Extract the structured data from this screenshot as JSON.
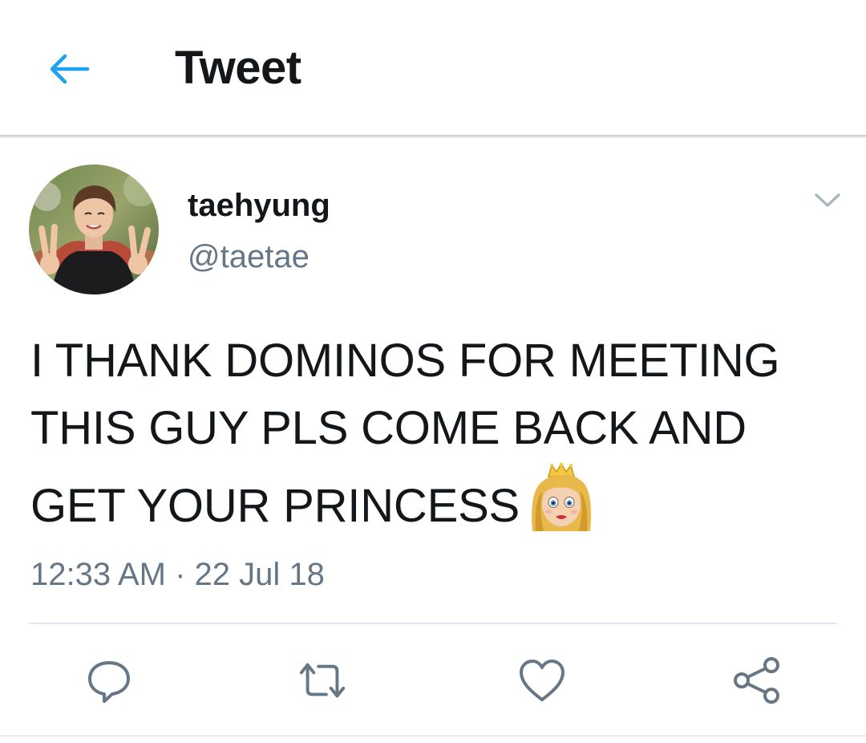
{
  "header": {
    "title": "Tweet",
    "back_icon": "arrow-left-icon",
    "accent_color": "#1da1f2"
  },
  "tweet": {
    "author": {
      "display_name": "taehyung",
      "handle": "@taetae",
      "avatar_icon": "profile-photo"
    },
    "menu_icon": "chevron-down-icon",
    "text": "I THANK DOMINOS FOR MEETING THIS GUY PLS COME BACK AND GET YOUR PRINCESS",
    "emoji": "princess-emoji",
    "timestamp": "12:33 AM · 22 Jul 18",
    "actions": [
      {
        "name": "reply",
        "icon": "reply-icon"
      },
      {
        "name": "retweet",
        "icon": "retweet-icon"
      },
      {
        "name": "like",
        "icon": "heart-icon"
      },
      {
        "name": "share",
        "icon": "share-icon"
      }
    ]
  },
  "colors": {
    "text_primary": "#14171a",
    "text_secondary": "#657786",
    "icon_gray": "#657786",
    "divider": "#e1e8ed"
  }
}
